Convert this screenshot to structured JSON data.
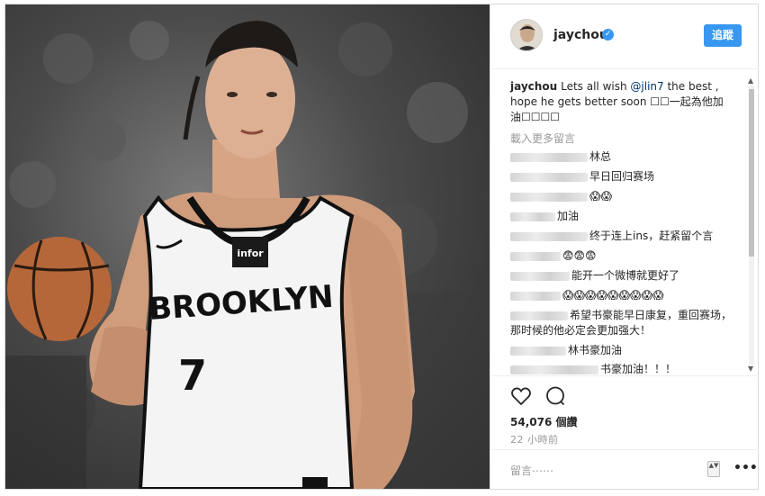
{
  "post": {
    "jersey_team": "BROOKLYN",
    "jersey_number": "7",
    "jersey_logo": "infor"
  },
  "header": {
    "username": "jaychou",
    "follow_label": "追蹤",
    "verified_glyph": "✓"
  },
  "caption": {
    "username": "jaychou",
    "text_before": "Lets all wish ",
    "mention": "@jlin7",
    "text_after": " the best , hope he gets better soon ☐☐一起為他加油☐☐☐☐"
  },
  "load_more": "載入更多留言",
  "comments": [
    {
      "text": "林总",
      "redacted_width": 86
    },
    {
      "text": "早日回归赛场",
      "redacted_width": 86
    },
    {
      "text": "😱😱",
      "redacted_width": 86
    },
    {
      "text": "加油",
      "redacted_width": 50
    },
    {
      "text": "终于连上ins，赶紧留个言",
      "redacted_width": 86
    },
    {
      "text": "😨😨😨",
      "redacted_width": 56
    },
    {
      "text": "能开一个微博就更好了",
      "redacted_width": 66
    },
    {
      "text": "😱😱😱😱😱😱😱😱😱",
      "redacted_width": 56
    },
    {
      "text": "希望书豪能早日康复，重回赛场，那时候的他必定会更加强大！",
      "redacted_width": 64
    },
    {
      "text": "林书豪加油",
      "redacted_width": 62
    },
    {
      "text": "书豪加油！！！",
      "redacted_width": 98
    }
  ],
  "likes": "54,076 個讚",
  "time": "22 小時前",
  "add_comment": {
    "placeholder": "留言⋯⋯",
    "more": "•••",
    "spinner": "▲▼"
  },
  "scroll": {
    "up": "▲",
    "down": "▼"
  },
  "colors": {
    "accent": "#3897f0",
    "mention": "#003569",
    "muted": "#999999"
  }
}
